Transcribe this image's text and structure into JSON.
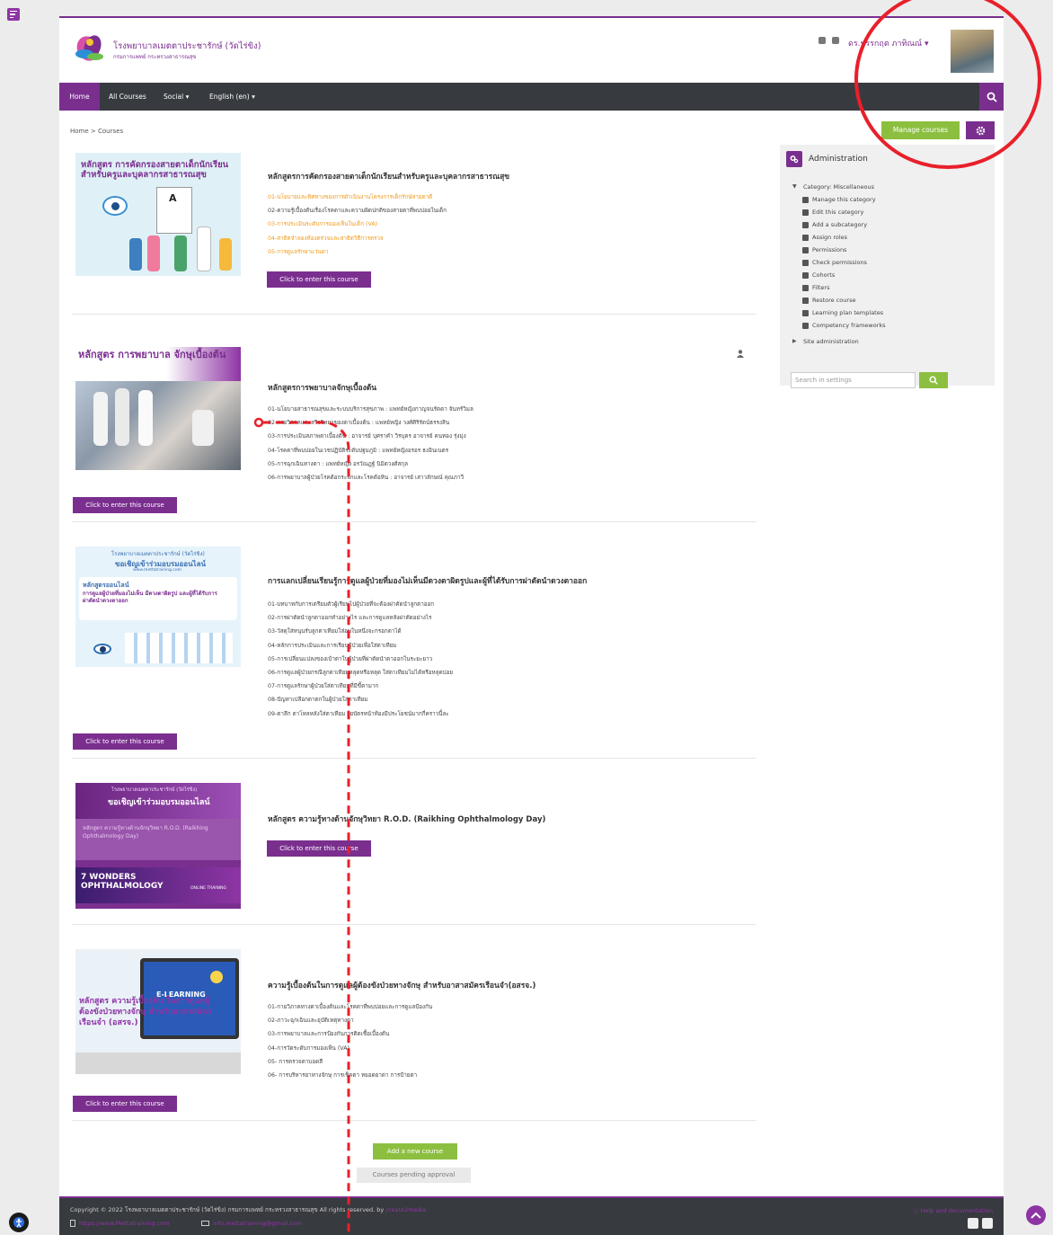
{
  "site": {
    "name": "โรงพยาบาลเมตตาประชารักษ์ (วัดไร่ขิง)",
    "subtitle": "กรมการแพทย์ กระทรวงสาธารณสุข"
  },
  "user": {
    "name": "ดร.ปรรกฤต ภาทิณณ์"
  },
  "nav": {
    "home": "Home",
    "all_courses": "All Courses",
    "social": "Social",
    "language": "English (en)"
  },
  "breadcrumb": {
    "home": "Home",
    "sep": ">",
    "current": "Courses"
  },
  "actions": {
    "manage_courses": "Manage courses"
  },
  "courses": [
    {
      "title": "หลักสูตรการคัดกรองสายตาเด็กนักเรียนสำหรับครูและบุคลากรสาธารณสุข",
      "thumb_text": "หลักสูตร การคัดกรองสายตาเด็กนักเรียน สำหรับครูและบุคลากรสาธารณสุข",
      "lessons": [
        "01-นโยบายและทิศทางของการดำเนินงานโครงการเด็กรักษ์สายตาดี",
        "02-ความรู้เบื้องต้นเรื่องโรคตาและความผิดปกติของสายตาที่พบบ่อยในเด็ก",
        "03-การประเมินระดับการมองเห็นในเด็ก (VA)",
        "04-สาธิตจำลองห้องตรวจและสาธิตวิธีการตรวจ",
        "05-การดูแลรักษาแว่นตา"
      ],
      "button": "Click to enter this course"
    },
    {
      "title": "หลักสูตรการพยาบาลจักษุเบื้องต้น",
      "thumb_text": "หลักสูตร การพยาบาล จักษุเบื้องต้น",
      "lessons": [
        "01-นโยบายสาธารณสุขและระบบบริการสุขภาพ : แพทย์หญิงกาญจนรัตดา จันทร์วิมล",
        "02-กายวิภาคและสรีรวิทยาของตาเบื้องต้น : แพทย์หญิง วงศ์ศิริรัตน์ธรรงสิน",
        "03-การประเมินสภาพตาเบื้องต้น : อาจารย์ บุศราคำ วิรบุตร อาจารย์ คนทอง รุ่งมุ่ง",
        "04-โรคตาที่พบบ่อยในเวชปฏิบัติระดับปฐมภูมิ : แพทย์หญิงอรอร ธงอินเนตร",
        "05-การฉุกเฉินทางตา : แพทย์หญิง อรวัณฎฐ์ นิมิตวงศ์สกุล",
        "06-การพยาบาลผู้ป่วยโรคต้อกระจกและโรคต้อหิน : อาจารย์ เสาวลักษณ์ คุณภาวี"
      ],
      "button": "Click to enter this course"
    },
    {
      "title": "การแลกเปลี่ยนเรียนรู้การดูแลผู้ป่วยที่มองไม่เห็นมีดวงตาผิดรูปและผู้ที่ได้รับการผ่าตัดนำดวงตาออก",
      "thumb_org": "โรงพยาบาลเมตตาประชารักษ์ (วัดไร่ขิง)",
      "thumb_invite": "ขอเชิญเข้าร่วมอบรมออนไลน์",
      "thumb_site": "www.mettatraining.com",
      "thumb_course": "หลักสูตรออนไลน์",
      "thumb_desc": "การดูแลผู้ป่วยที่มองไม่เห็น มีดวงตาผิดรูป และผู้ที่ได้รับการผ่าตัดนำดวงตาออก",
      "lessons": [
        "01-บทบาทกับการเตรียมตัวผู้เรียนไปผู้ป่วยที่จะต้องผ่าตัดนำลูกตาออก",
        "02-การผ่าตัดนำลูกตาออกทำอย่างไร และการดูแลหลังผ่าตัดอย่างไร",
        "03-วัสดุใส่หนุนรับลูกตาเทียมใส่อบในหนึ่งจะกรอกตาได้",
        "04-หลักการประเมินและการเรียนผู้ป่วยเพื่อใส่ตาเทียม",
        "05-การเปลี่ยนแปลงของเบ้าตาในผู้ป่วยที่ผ่าตัดนำตาออกในระยะยาว",
        "06-การดูแลผู้ป่วยกรณีลูกตาเทียมหลุดหรือหลุด ใส่ตาเทียมไม่ได้หรือหลุดบ่อย",
        "07-การดูแลรักษาผู้ป่วยใส่ตาเทียมที่มีขี้ตามาก",
        "08-ปัญหาเปลือกตาตกในผู้ป่วยใส่ตาเทียม",
        "09-ตาลึก ตาโหลหลังใส่ตาเทียม ใยบัตรหน้าท้องมีประโยชน์มากกี่คราวนี้ละ"
      ],
      "button": "Click to enter this course"
    },
    {
      "title": "หลักสูตร ความรู้ทางด้านจักษุวิทยา R.O.D. (Raikhing Ophthalmology Day)",
      "thumb_org": "โรงพยาบาลเมตตาประชารักษ์ (วัดไร่ขิง)",
      "thumb_invite": "ขอเชิญเข้าร่วมอบรมออนไลน์",
      "thumb_course": "หลักสูตร ความรู้ทางด้านจักษุวิทยา R.O.D. (Raikhing Ophthalmology Day)",
      "thumb_banner": "7 WONDERS OPHTHALMOLOGY",
      "thumb_online": "ONLINE TRAINING",
      "button": "Click to enter this course"
    },
    {
      "title": "ความรู้เบื้องต้นในการดูแลผู้ต้องขังป่วยทางจักษุ สำหรับอาสาสมัครเรือนจำ(อสรจ.)",
      "thumb_screen": "E-LEARNING",
      "thumb_text": "หลักสูตร ความรู้เบื้องต้น ในการดูแลผู้ต้องขังป่วยทางจักษุ สำหรับอาสาสมัครเรือนจำ (อสรจ.)",
      "lessons": [
        "01-กายวิภาคทางตาเบื้องต้นและโรคตาที่พบบ่อยและการดูแลป้องกัน",
        "02-ภาวะฉุกเฉินและอุบัติเหตุทางตา",
        "03-การพยาบาลและการป้องกันการติดเชื้อเบื้องต้น",
        "04-การวัดระดับการมองเห็น (VA)",
        "05- การตรวจตาบอดสี",
        "06- การบริหารยาทางจักษุ การเช็ดตา หยอดยาตา การป้ายตา"
      ],
      "button": "Click to enter this course"
    }
  ],
  "admin": {
    "title": "Administration",
    "category": "Category: Miscellaneous",
    "items": [
      "Manage this category",
      "Edit this category",
      "Add a subcategory",
      "Assign roles",
      "Permissions",
      "Check permissions",
      "Cohorts",
      "Filters",
      "Restore course",
      "Learning plan templates",
      "Competency frameworks"
    ],
    "site_admin": "Site administration",
    "search_placeholder": "Search in settings"
  },
  "bottom": {
    "add_course": "Add a new course",
    "pending": "Courses pending approval"
  },
  "footer": {
    "copyright": "Copyright © 2022 โรงพยาบาลเมตตาประชารักษ์ (วัดไร่ขิง) กรมการแพทย์ กระทรวงสาธารณสุข All rights reserved. by",
    "credit": "create2media",
    "url": "https://www.Mettatraining.com",
    "email": "info.mettatraining@gmail.com",
    "help": "Help and documentation"
  },
  "colors": {
    "brand": "#7a2f8f",
    "accent_green": "#8cbf3f",
    "navbar": "#373a3f",
    "lesson_orange": "#f09a1b",
    "annotation_red": "#e8202a"
  },
  "icons": [
    "drawer-toggle-icon",
    "notification-bell-icon",
    "messages-icon",
    "search-icon",
    "gear-icon",
    "person-icon",
    "scroll-top-icon",
    "accessibility-icon"
  ]
}
